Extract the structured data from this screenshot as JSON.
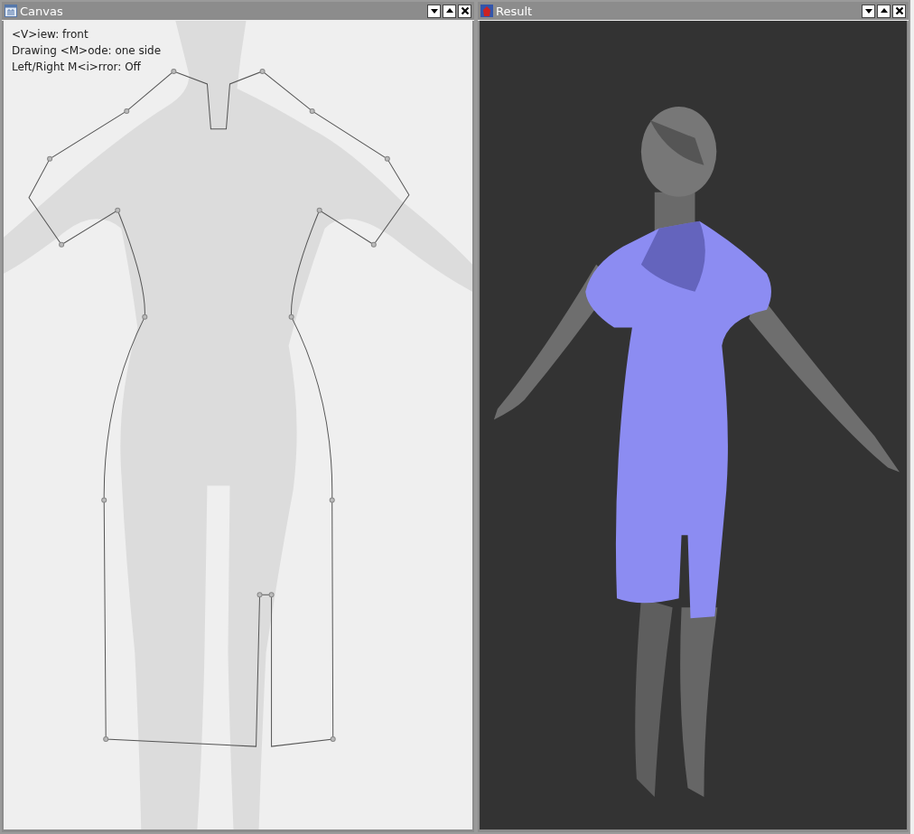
{
  "windows": [
    {
      "title": "Canvas",
      "kind": "canvas",
      "info_lines": [
        "<V>iew: front",
        "Drawing <M>ode: one side",
        "Left/Right M<i>rror: Off"
      ]
    },
    {
      "title": "Result",
      "kind": "viewer"
    }
  ]
}
